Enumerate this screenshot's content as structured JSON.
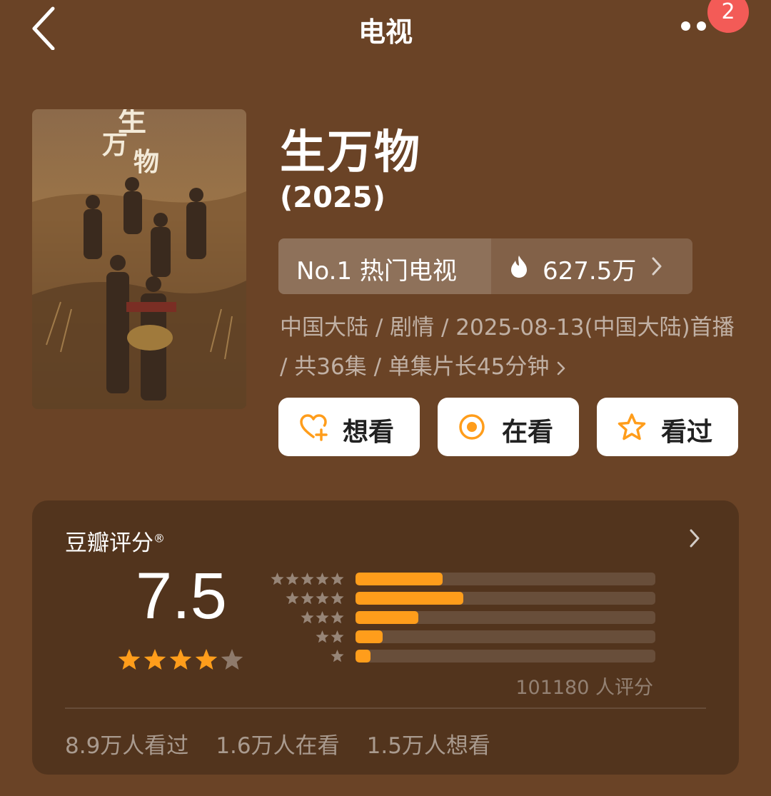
{
  "header": {
    "title": "电视",
    "notification_count": "2"
  },
  "show": {
    "title": "生万物",
    "year": "(2025)",
    "rank_label": "No.1 热门电视",
    "heat": "627.5万",
    "meta": "中国大陆 / 剧情 / 2025-08-13(中国大陆)首播 / 共36集 / 单集片长45分钟"
  },
  "actions": {
    "want": "想看",
    "watching": "在看",
    "watched": "看过"
  },
  "rating": {
    "brand": "豆瓣评分",
    "brand_mark": "®",
    "score": "7.5",
    "stars_filled": 4,
    "distribution": [
      {
        "stars": 5,
        "percent": 29
      },
      {
        "stars": 4,
        "percent": 36
      },
      {
        "stars": 3,
        "percent": 21
      },
      {
        "stars": 2,
        "percent": 9
      },
      {
        "stars": 1,
        "percent": 5
      }
    ],
    "count_text": "101180 人评分",
    "stats": [
      "8.9万人看过",
      "1.6万人在看",
      "1.5万人想看"
    ]
  },
  "colors": {
    "background": "#6a4326",
    "accent": "#ff9d1b",
    "badge": "#f35b57"
  }
}
